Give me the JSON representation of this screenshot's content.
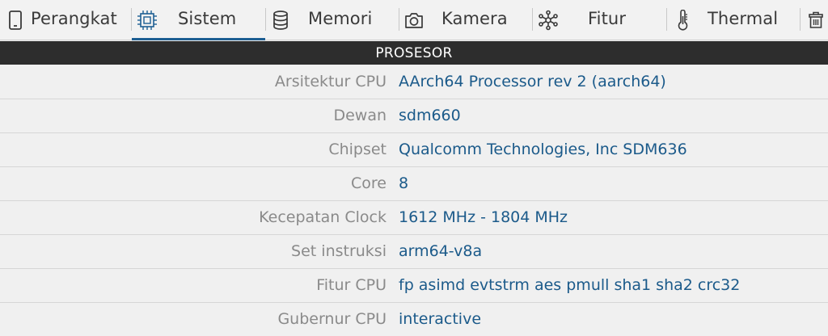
{
  "tabs": [
    {
      "label": "Perangkat",
      "icon": "phone-icon"
    },
    {
      "label": "Sistem",
      "icon": "cpu-chip-icon",
      "selected": true
    },
    {
      "label": "Memori",
      "icon": "database-icon"
    },
    {
      "label": "Kamera",
      "icon": "camera-icon"
    },
    {
      "label": "Fitur",
      "icon": "molecule-icon"
    },
    {
      "label": "Thermal",
      "icon": "thermometer-icon"
    },
    {
      "label": "",
      "icon": "trash-icon"
    }
  ],
  "section": {
    "title": "PROSESOR"
  },
  "rows": [
    {
      "key": "Arsitektur CPU",
      "value": "AArch64 Processor rev 2 (aarch64)"
    },
    {
      "key": "Dewan",
      "value": "sdm660"
    },
    {
      "key": "Chipset",
      "value": "Qualcomm Technologies, Inc SDM636"
    },
    {
      "key": "Core",
      "value": "8"
    },
    {
      "key": "Kecepatan Clock",
      "value": "1612 MHz - 1804 MHz"
    },
    {
      "key": "Set instruksi",
      "value": "arm64-v8a"
    },
    {
      "key": "Fitur CPU",
      "value": "fp asimd evtstrm aes pmull sha1 sha2 crc32"
    },
    {
      "key": "Gubernur CPU",
      "value": "interactive"
    }
  ],
  "colors": {
    "accent": "#1d5f93",
    "value_text": "#1b5a8a",
    "key_text": "#8a8a8a",
    "header_bg": "#2d2d2d"
  }
}
